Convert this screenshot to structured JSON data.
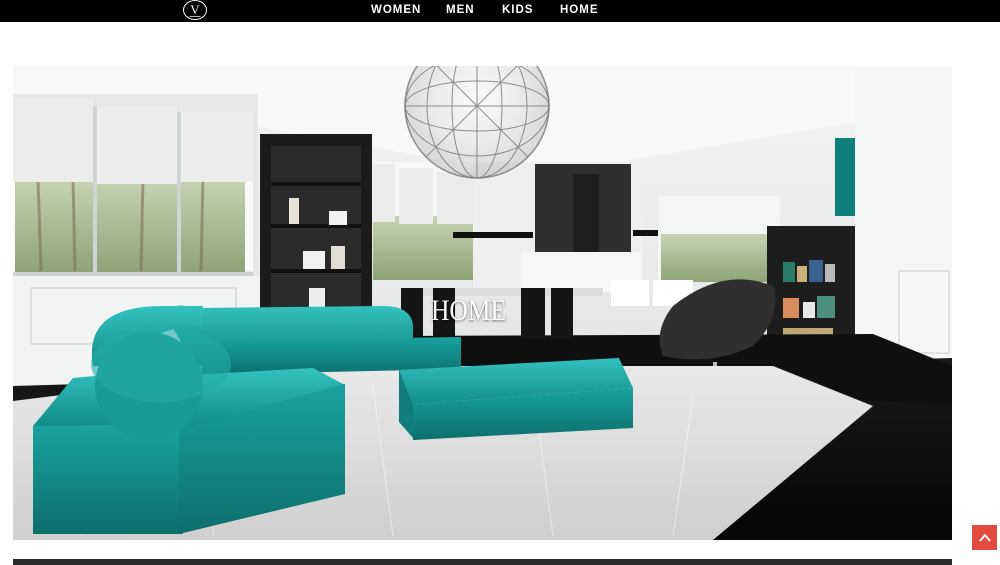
{
  "header": {
    "logo_letter": "V",
    "nav": [
      {
        "label": "WOMEN"
      },
      {
        "label": "MEN"
      },
      {
        "label": "KIDS"
      },
      {
        "label": "HOME"
      }
    ]
  },
  "hero": {
    "caption": "HOME"
  },
  "scroll_top": {
    "icon": "chevron-up-icon"
  },
  "colors": {
    "topbar": "#000000",
    "accent": "#e04a3f",
    "sofa": "#1fa7a4"
  }
}
